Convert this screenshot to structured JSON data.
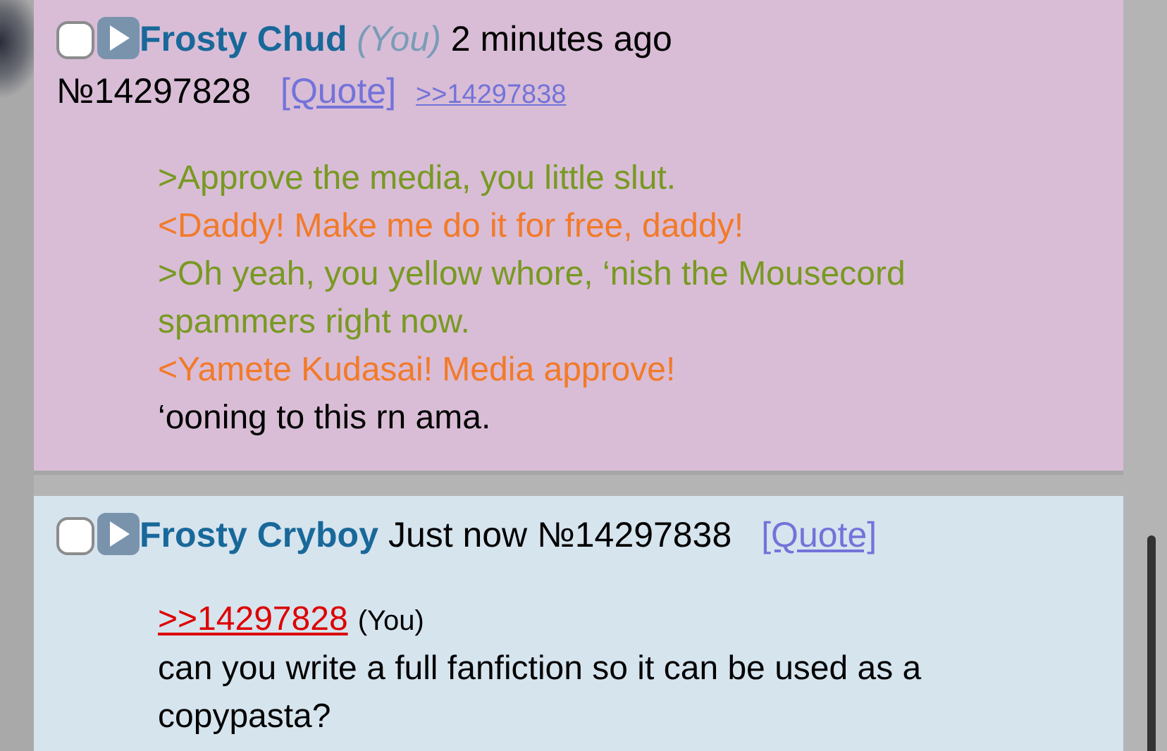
{
  "posts": [
    {
      "highlighted": true,
      "name": "Frosty Chud",
      "you_tag": "(You)",
      "time": "2 minutes ago",
      "number": "№14297828",
      "quote": "[Quote]",
      "backlinks": [
        ">>14297838"
      ],
      "lines": [
        {
          "kind": "green",
          "text": ">Approve the media, you little slut."
        },
        {
          "kind": "orange",
          "text": "<Daddy! Make me do it for free, daddy!"
        },
        {
          "kind": "green",
          "text": ">Oh yeah, you yellow whore, ‘nish the Mousecord spammers right now."
        },
        {
          "kind": "orange",
          "text": "<Yamete Kudasai! Media approve!"
        },
        {
          "kind": "plain",
          "text": "‘ooning to this rn ama."
        }
      ]
    },
    {
      "highlighted": false,
      "name": "Frosty Cryboy",
      "time": "Just now",
      "number": "№14297838",
      "quote": "[Quote]",
      "reply_link": ">>14297828",
      "reply_you": "(You)",
      "lines": [
        {
          "kind": "plain",
          "text": "can you write a full fanfiction so it can be used as a copypasta?"
        }
      ]
    }
  ]
}
